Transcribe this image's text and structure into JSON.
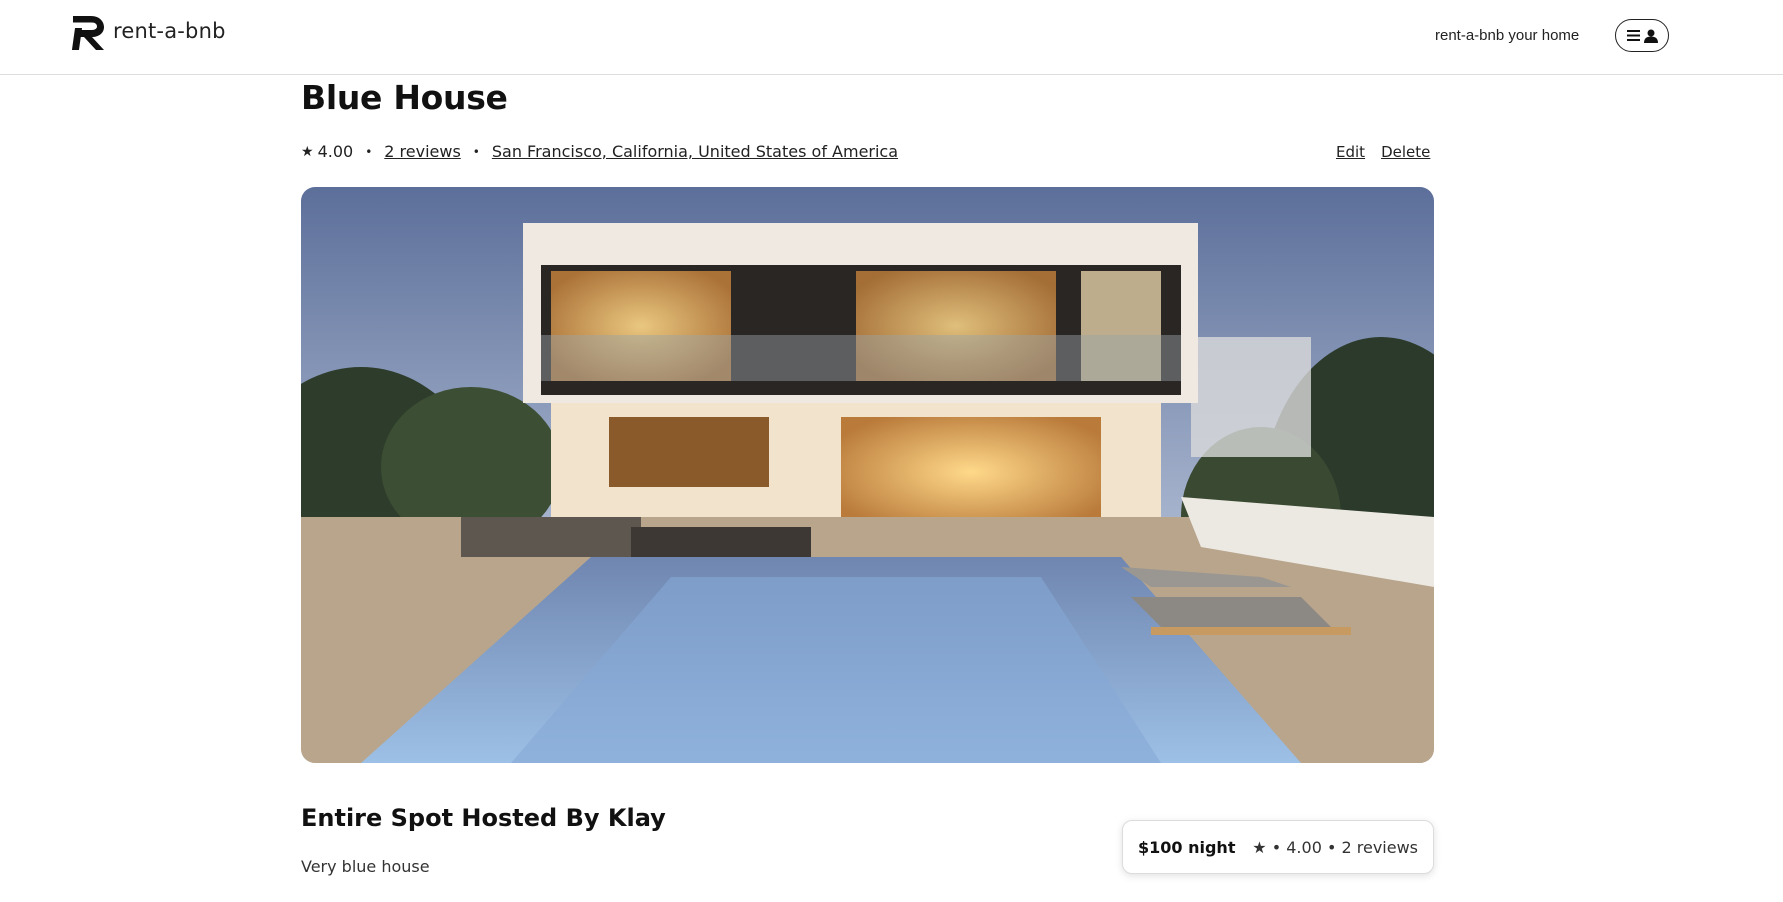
{
  "header": {
    "brand": "rent-a-bnb",
    "host_link": "rent-a-bnb your home",
    "menu_icon": "hamburger-icon",
    "user_icon": "user-icon"
  },
  "listing": {
    "title": "Blue House",
    "star": "★",
    "rating": "4.00",
    "reviews_link": "2 reviews",
    "location": "San Francisco, California, United States of America",
    "edit_label": "Edit",
    "delete_label": "Delete",
    "hosted_by": "Entire Spot Hosted By Klay",
    "description": "Very blue house"
  },
  "booking": {
    "price": "$100 night",
    "rating_summary": "★ • 4.00 • 2 reviews"
  }
}
